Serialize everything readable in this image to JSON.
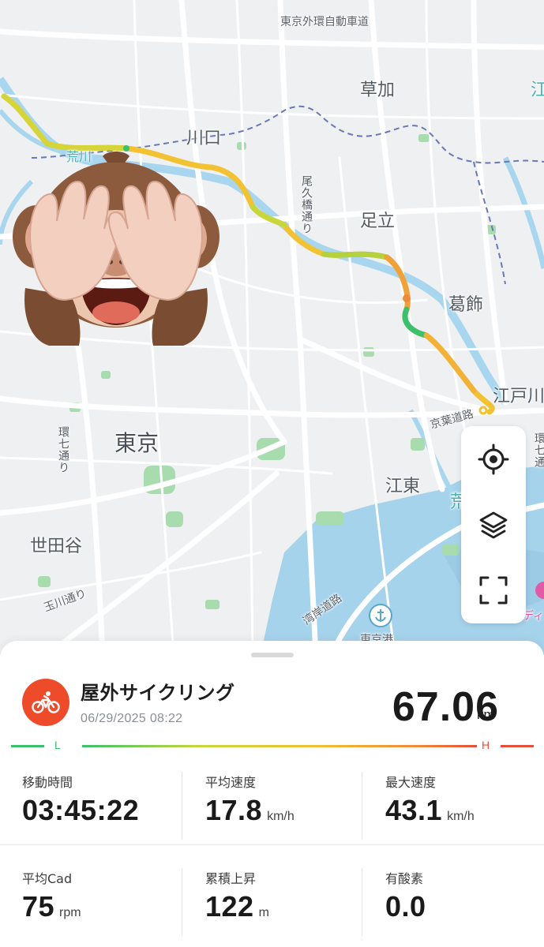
{
  "map": {
    "labels": {
      "expressway": "東京外環自動車道",
      "soka": "草加",
      "kawaguchi": "川口",
      "adachi": "足立",
      "katsushika": "葛飾",
      "tokyo": "東京",
      "koto": "江東",
      "setagaya": "世田谷",
      "edogawa": "江戸川",
      "keiyo_road": "京葉道路",
      "ara_river": "荒川",
      "oku_bashi": "尾久橋通り",
      "kan7": "環七通り",
      "kan7_right": "環七通",
      "tamagawa": "玉川通り",
      "wangan": "湾岸道路",
      "tokyo_port": "東京港",
      "edge_e": "江",
      "edge_ara": "荒",
      "edge_dis": "ディス"
    },
    "controls": {
      "locate_icon": "crosshair-icon",
      "layers_icon": "layers-icon",
      "fullscreen_icon": "fullscreen-icon"
    },
    "route_colors": [
      "#3cc06b",
      "#c8d63c",
      "#f5c331",
      "#ee8a3a"
    ]
  },
  "activity": {
    "type_icon": "bicycle-icon",
    "icon_color": "#ee4b2b",
    "title": "屋外サイクリング",
    "datetime": "06/29/2025 08:22",
    "distance": "67.06",
    "distance_unit": "km"
  },
  "legend": {
    "low": "L",
    "high": "H"
  },
  "stats": {
    "moving_time": {
      "label": "移動時間",
      "value": "03:45:22",
      "unit": ""
    },
    "avg_speed": {
      "label": "平均速度",
      "value": "17.8",
      "unit": "km/h"
    },
    "max_speed": {
      "label": "最大速度",
      "value": "43.1",
      "unit": "km/h"
    },
    "avg_cad": {
      "label": "平均Cad",
      "value": "75",
      "unit": "rpm"
    },
    "elev_gain": {
      "label": "累積上昇",
      "value": "122",
      "unit": "m"
    },
    "aerobic": {
      "label": "有酸素",
      "value": "0.0",
      "unit": ""
    }
  }
}
